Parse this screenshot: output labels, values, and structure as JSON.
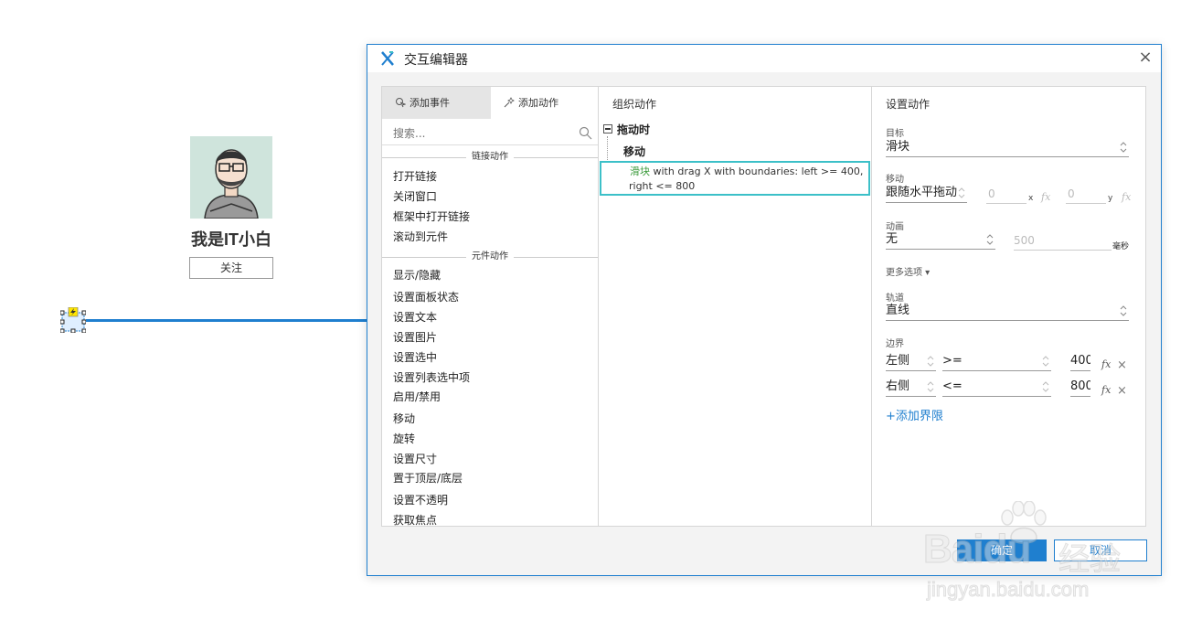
{
  "profile": {
    "name": "我是IT小白",
    "follow_label": "关注"
  },
  "dialog": {
    "title": "交互编辑器",
    "close": "×",
    "left": {
      "tab_events": "添加事件",
      "tab_actions": "添加动作",
      "search_placeholder": "搜索...",
      "sections": [
        {
          "label": "链接动作",
          "items": [
            "打开链接",
            "关闭窗口",
            "框架中打开链接",
            "滚动到元件"
          ]
        },
        {
          "label": "元件动作",
          "items": [
            "显示/隐藏",
            "设置面板状态",
            "设置文本",
            "设置图片",
            "设置选中",
            "设置列表选中项",
            "启用/禁用",
            "移动",
            "旋转",
            "设置尺寸",
            "置于顶层/底层",
            "设置不透明",
            "获取焦点"
          ]
        }
      ]
    },
    "middle": {
      "title": "组织动作",
      "event": "拖动时",
      "case": "移动",
      "action_target": "滑块",
      "action_line1": " with drag X  with boundaries: left >= 400,",
      "action_line2": "right <= 800"
    },
    "right": {
      "title": "设置动作",
      "target_label": "目标",
      "target_value": "滑块",
      "move_label": "移动",
      "move_value": "跟随水平拖动",
      "x_value": "0",
      "x_suffix": "x",
      "y_value": "0",
      "y_suffix": "y",
      "fx": "fx",
      "anim_label": "动画",
      "anim_value": "无",
      "anim_duration": "500",
      "anim_unit": "毫秒",
      "more_options": "更多选项 ▾",
      "track_label": "轨道",
      "track_value": "直线",
      "bounds_label": "边界",
      "bounds": [
        {
          "side": "左侧",
          "op": ">=",
          "value": "400"
        },
        {
          "side": "右侧",
          "op": "<=",
          "value": "800"
        }
      ],
      "delete": "×",
      "add_bound": "+添加界限"
    },
    "ok_label": "确定",
    "cancel_label": "取消"
  },
  "watermark": {
    "brand": "Baidu",
    "product": "经验",
    "url": "jingyan.baidu.com"
  },
  "colors": {
    "accent": "#1f7fcf",
    "highlight": "#3cc0c8",
    "target_green": "#3a9a3a"
  }
}
